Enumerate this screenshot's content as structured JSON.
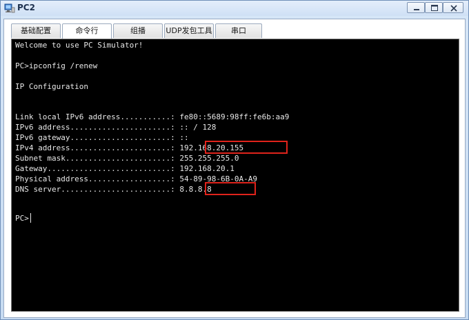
{
  "window": {
    "title": "PC2",
    "icon": "pc-icon"
  },
  "tabs": [
    {
      "label": "基础配置"
    },
    {
      "label": "命令行"
    },
    {
      "label": "组播"
    },
    {
      "label": "UDP发包工具"
    },
    {
      "label": "串口"
    }
  ],
  "active_tab": "命令行",
  "terminal": {
    "lines": [
      "Welcome to use PC Simulator!",
      "",
      "PC>ipconfig /renew",
      "",
      "IP Configuration",
      "",
      "",
      "Link local IPv6 address...........: fe80::5689:98ff:fe6b:aa9",
      "IPv6 address......................: :: / 128",
      "IPv6 gateway......................: ::",
      "IPv4 address......................: 192.168.20.155",
      "Subnet mask.......................: 255.255.255.0",
      "Gateway...........................: 192.168.20.1",
      "Physical address..................: 54-89-98-6B-0A-A9",
      "DNS server........................: 8.8.8.8",
      "",
      "",
      "PC>"
    ],
    "highlighted": [
      "192.168.20.155",
      "8.8.8.8"
    ]
  },
  "colors": {
    "terminal_bg": "#000000",
    "terminal_fg": "#e8e8e8",
    "highlight": "#e0231b"
  }
}
